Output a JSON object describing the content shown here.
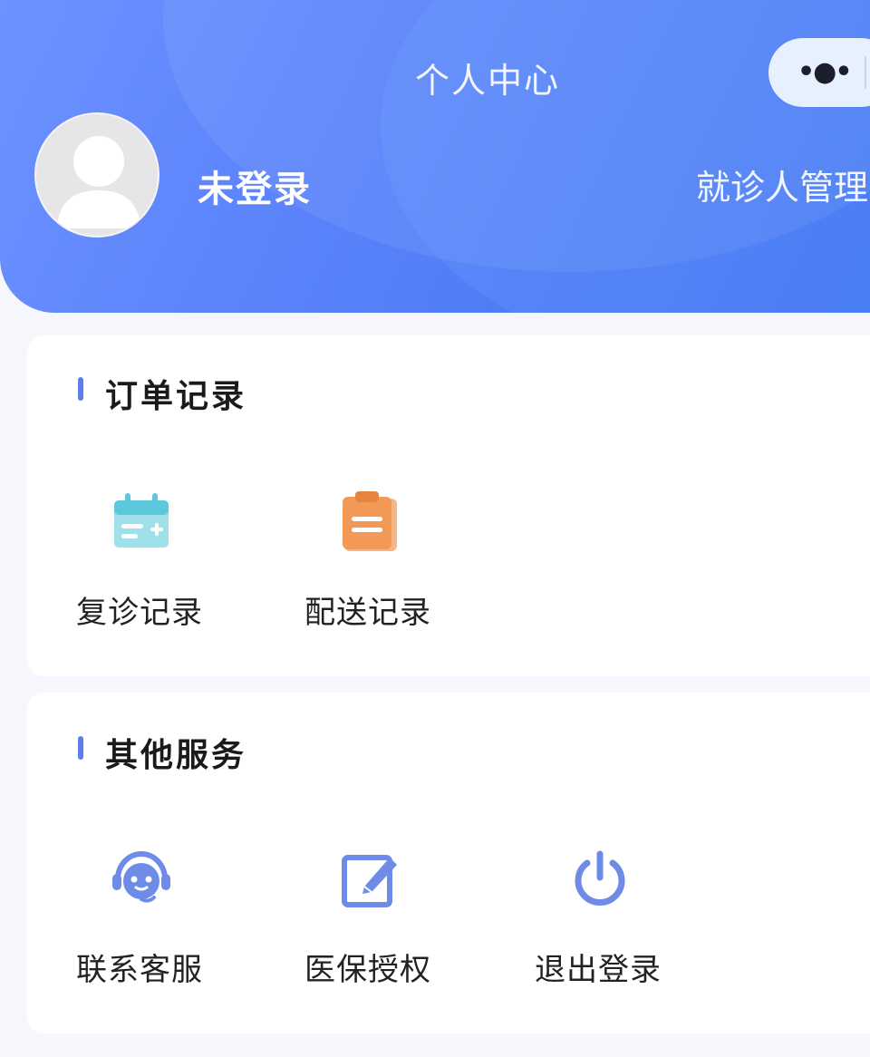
{
  "header": {
    "title": "个人中心",
    "more_icon": "more-dots-icon",
    "username": "未登录",
    "patient_manage_label": "就诊人管理"
  },
  "orders": {
    "title": "订单记录",
    "items": [
      {
        "label": "复诊记录",
        "icon": "calendar-icon",
        "color": "#5cc8dc"
      },
      {
        "label": "配送记录",
        "icon": "clipboard-icon",
        "color": "#f29a55"
      }
    ]
  },
  "services": {
    "title": "其他服务",
    "items": [
      {
        "label": "联系客服",
        "icon": "headset-icon",
        "color": "#6f8be8"
      },
      {
        "label": "医保授权",
        "icon": "edit-icon",
        "color": "#6f8be8"
      },
      {
        "label": "退出登录",
        "icon": "power-icon",
        "color": "#6f8be8"
      }
    ]
  },
  "colors": {
    "header_gradient_start": "#6d92ff",
    "header_gradient_end": "#3f74f2",
    "section_accent": "#5d7ee8",
    "background": "#f6f7fc"
  }
}
